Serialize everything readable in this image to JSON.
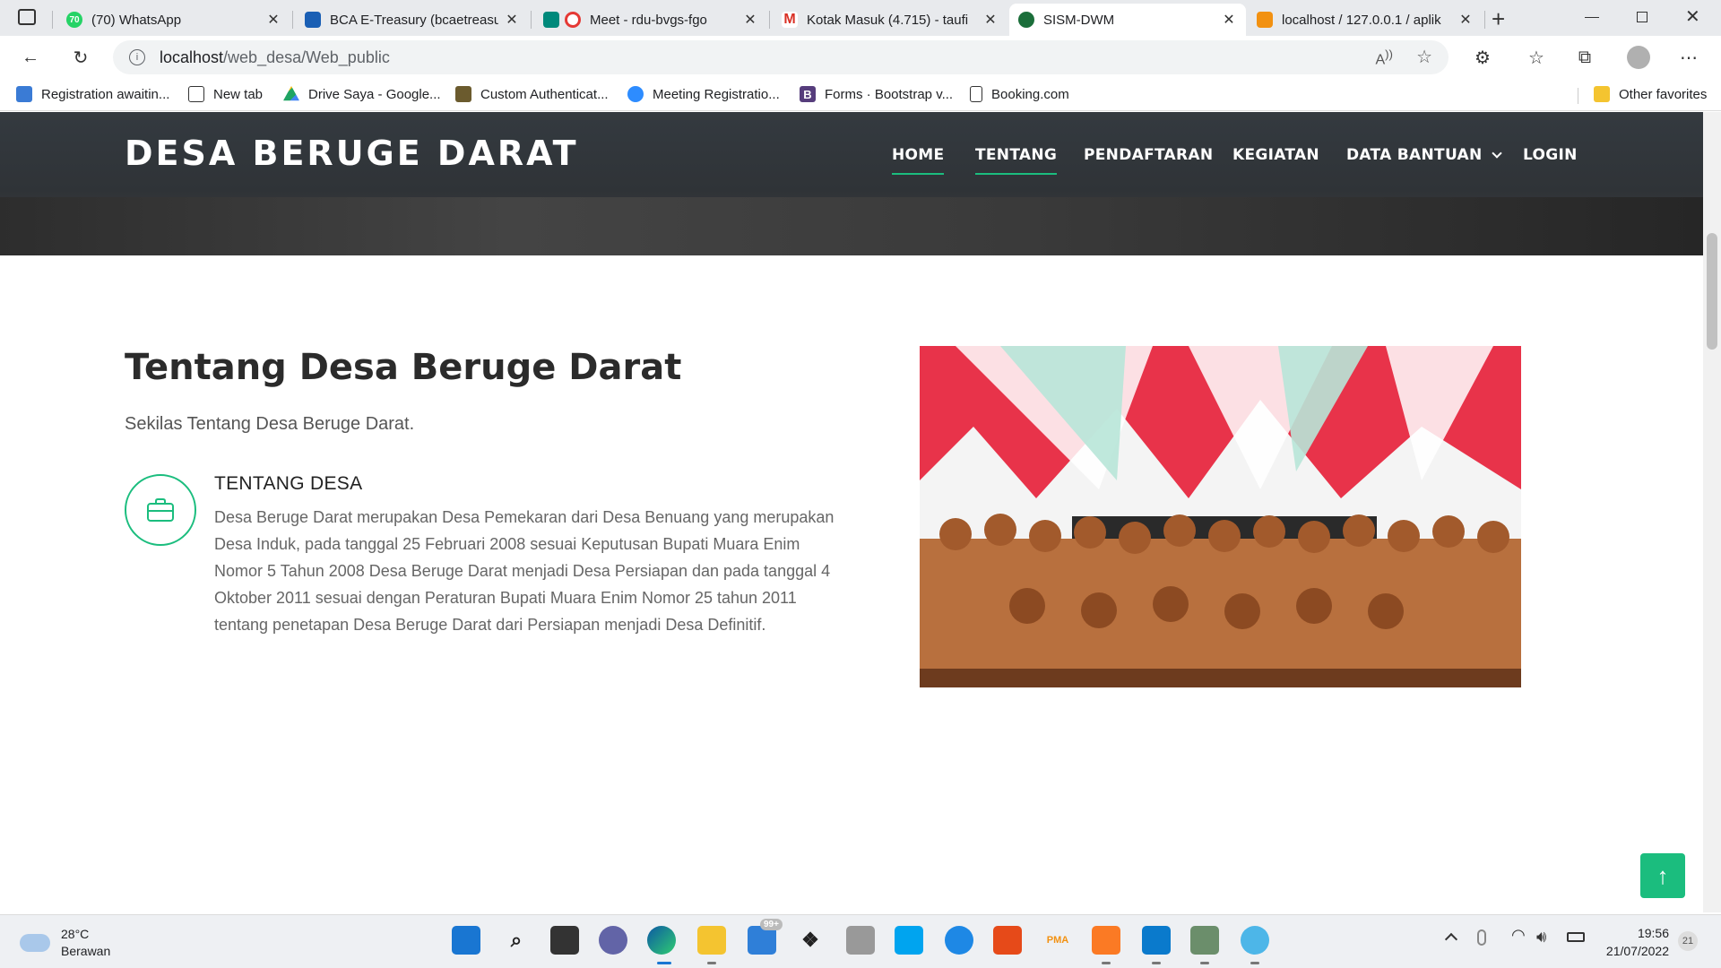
{
  "browser": {
    "tabs": [
      {
        "title": "(70) WhatsApp",
        "badge": "70",
        "icon": "whatsapp-icon",
        "color": "#25d366"
      },
      {
        "title": "BCA E-Treasury (bcaetreasur",
        "icon": "bca-icon",
        "color": "#1a5fb4"
      },
      {
        "title": "Meet - rdu-bvgs-fgo",
        "icon": "google-meet-icon",
        "color": "#e53935"
      },
      {
        "title": "Kotak Masuk (4.715) - taufi",
        "icon": "gmail-icon",
        "color": "#d93025"
      },
      {
        "title": "SISM-DWM",
        "icon": "shield-icon",
        "color": "#1b6e3a"
      },
      {
        "title": "localhost / 127.0.0.1 / aplik",
        "icon": "phpmyadmin-icon",
        "color": "#f29111"
      }
    ],
    "url_host": "localhost",
    "url_path": "/web_desa/Web_public",
    "bookmarks": [
      {
        "label": "Registration awaitin...",
        "icon": "bookmark-site-icon",
        "color": "#3a7bd5"
      },
      {
        "label": "New tab",
        "icon": "new-tab-icon",
        "color": "#ffffff"
      },
      {
        "label": "Drive Saya - Google...",
        "icon": "google-drive-icon",
        "color": "#1fa463"
      },
      {
        "label": "Custom Authenticat...",
        "icon": "custom-site-icon",
        "color": "#6b5b2e"
      },
      {
        "label": "Meeting Registratio...",
        "icon": "zoom-icon",
        "color": "#2d8cff"
      },
      {
        "label": "Forms · Bootstrap v...",
        "icon": "bootstrap-icon",
        "color": "#563d7c"
      },
      {
        "label": "Booking.com",
        "icon": "page-icon",
        "color": "#ffffff"
      }
    ],
    "other_favorites": "Other favorites"
  },
  "site": {
    "brand": "DESA BERUGE DARAT",
    "nav": [
      {
        "label": "HOME"
      },
      {
        "label": "TENTANG"
      },
      {
        "label": "PENDAFTARAN"
      },
      {
        "label": "KEGIATAN"
      },
      {
        "label": "DATA BANTUAN"
      },
      {
        "label": "LOGIN"
      }
    ],
    "about": {
      "title": "Tentang Desa Beruge Darat",
      "subtitle": "Sekilas Tentang Desa Beruge Darat.",
      "feature_title": "TENTANG DESA",
      "feature_text": "Desa Beruge Darat merupakan Desa Pemekaran dari Desa Benuang yang merupakan Desa Induk, pada tanggal 25 Februari 2008 sesuai Keputusan Bupati Muara Enim Nomor 5 Tahun 2008 Desa Beruge Darat menjadi Desa Persiapan dan pada tanggal 4 Oktober 2011 sesuai dengan Peraturan Bupati Muara Enim Nomor 25 tahun 2011 tentang penetapan Desa Beruge Darat dari Persiapan menjadi Desa Definitif."
    },
    "accent_color": "#1bbd7e"
  },
  "taskbar": {
    "weather_temp": "28°C",
    "weather_desc": "Berawan",
    "mail_badge": "99+",
    "time": "19:56",
    "date": "21/07/2022",
    "notif_count": "21"
  }
}
